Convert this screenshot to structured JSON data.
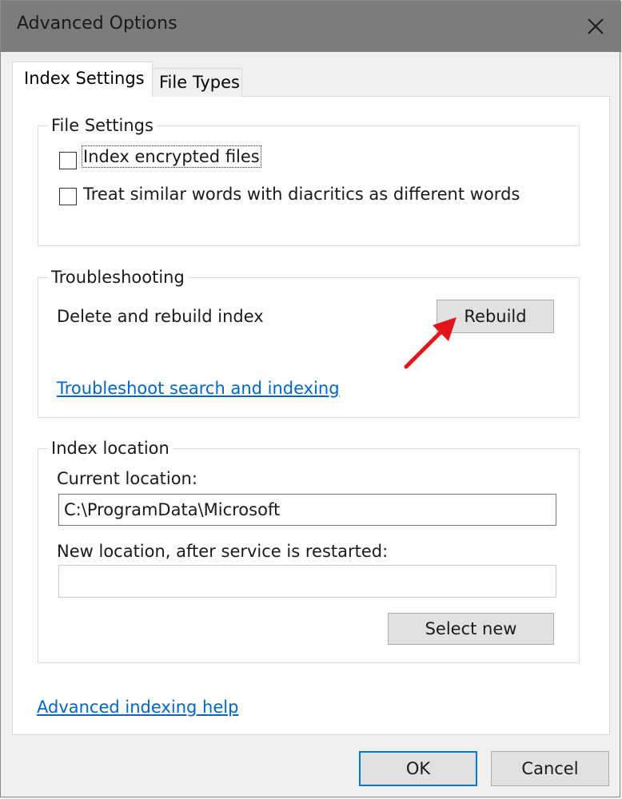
{
  "window": {
    "title": "Advanced Options"
  },
  "tabs": [
    {
      "label": "Index Settings",
      "active": true
    },
    {
      "label": "File Types",
      "active": false
    }
  ],
  "file_settings": {
    "legend": "File Settings",
    "options": [
      {
        "label": "Index encrypted files",
        "checked": false
      },
      {
        "label": "Treat similar words with diacritics as different words",
        "checked": false
      }
    ]
  },
  "troubleshooting": {
    "legend": "Troubleshooting",
    "rebuild_text": "Delete and rebuild index",
    "rebuild_button": "Rebuild",
    "troubleshoot_link": "Troubleshoot search and indexing"
  },
  "index_location": {
    "legend": "Index location",
    "current_label": "Current location:",
    "current_value": "C:\\ProgramData\\Microsoft",
    "new_label": "New location, after service is restarted:",
    "new_value": "",
    "select_new_button": "Select new"
  },
  "help_link": "Advanced indexing help",
  "footer": {
    "ok": "OK",
    "cancel": "Cancel"
  },
  "colors": {
    "titlebar": "#7c7c7c",
    "link": "#0066cc",
    "default_button_border": "#0078d7",
    "annotation_arrow": "#e3141b"
  },
  "icons": {
    "close": "close-icon",
    "annotation": "red-arrow-annotation"
  }
}
